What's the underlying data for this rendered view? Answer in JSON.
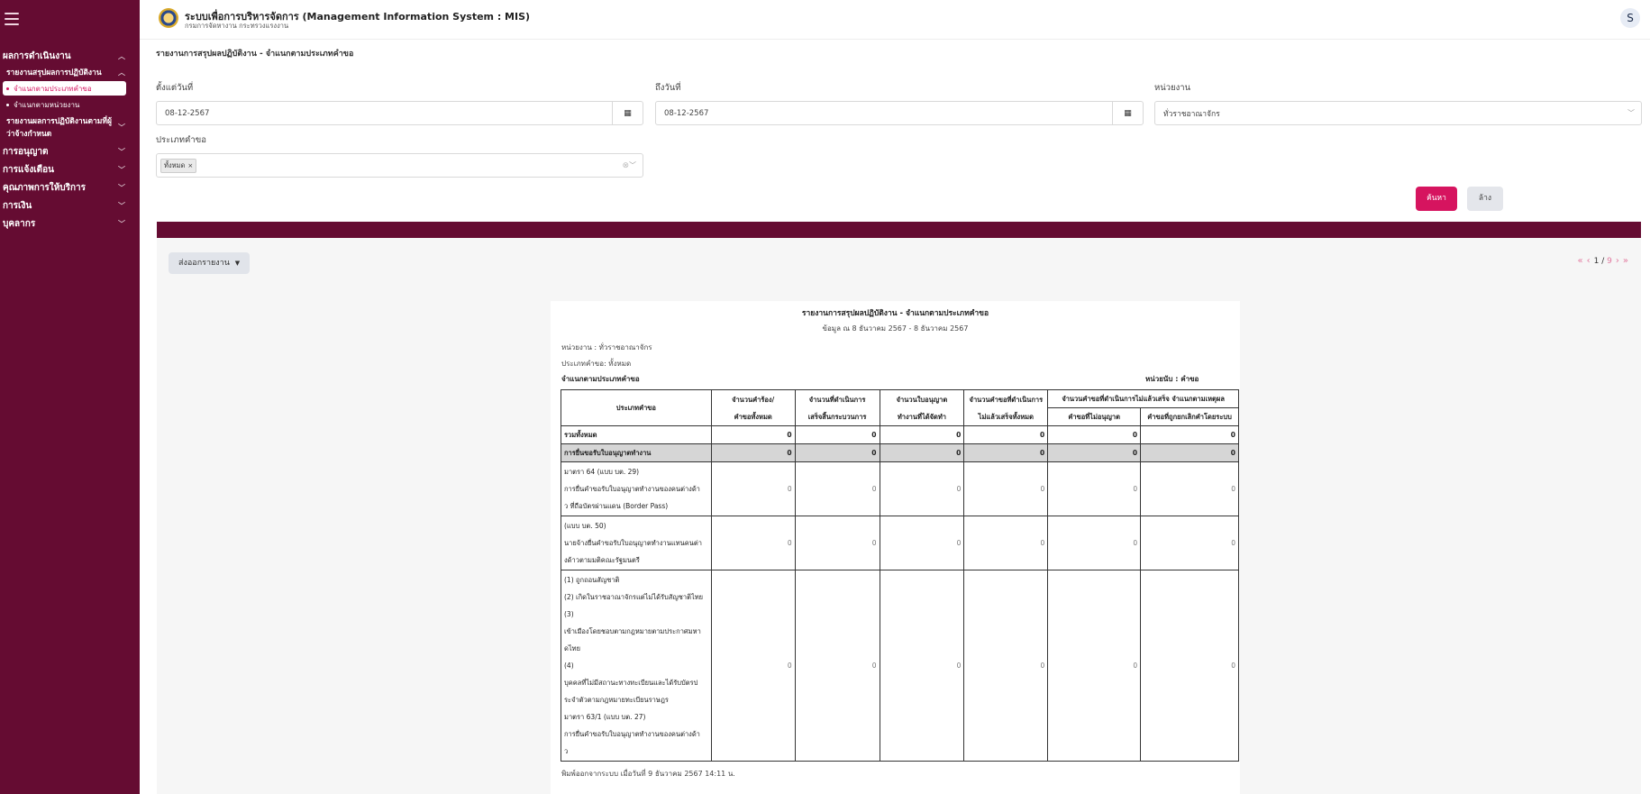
{
  "app": {
    "title": "ระบบเพื่อการบริหารจัดการ (Management Information System : MIS)",
    "subtitle": "กรมการจัดหางาน กระทรวงแรงงาน",
    "avatar_initial": "S"
  },
  "sidebar": {
    "groups": [
      {
        "label": "ผลการดำเนินงาน",
        "chevron": "^"
      },
      {
        "label": "การอนุญาต",
        "chevron": "v"
      },
      {
        "label": "การแจ้งเตือน",
        "chevron": "v"
      },
      {
        "label": "คุณภาพการให้บริการ",
        "chevron": "v"
      },
      {
        "label": "การเงิน",
        "chevron": "v"
      },
      {
        "label": "บุคลากร",
        "chevron": "v"
      }
    ],
    "sub1": {
      "label": "รายงานสรุปผลการปฏิบัติงาน",
      "chevron": "^"
    },
    "items": [
      {
        "label": "จำแนกตามประเภทคำขอ"
      },
      {
        "label": "จำแนกตามหน่วยงาน"
      }
    ],
    "sub2": {
      "line1": "รายงานผลการปฏิบัติงานตามที่ผู้",
      "line2": "ว่าจ้างกำหนด",
      "chevron": "v"
    }
  },
  "page": {
    "title": "รายงานการสรุปผลปฏิบัติงาน - จำแนกตามประเภทคำขอ"
  },
  "filters": {
    "from_label": "ตั้งแต่วันที่",
    "from_value": "08-12-2567",
    "to_label": "ถึงวันที่",
    "to_value": "08-12-2567",
    "unit_label": "หน่วยงาน",
    "unit_value": "ทั่วราชอาณาจักร",
    "type_label": "ประเภทคำขอ",
    "type_tag": "ทั้งหมด",
    "calendar_icon": "▦"
  },
  "buttons": {
    "search": "ค้นหา",
    "clear": "ล้าง",
    "export": "ส่งออกรายงาน"
  },
  "pager": {
    "current": "1",
    "total": "9"
  },
  "report": {
    "title": "รายงานการสรุปผลปฏิบัติงาน - จำแนกตามประเภทคำขอ",
    "subtitle": "ข้อมูล ณ 8 ธันวาคม 2567 - 8 ธันวาคม 2567",
    "unit_line": "หน่วยงาน : ทั่วราชอาณาจักร",
    "type_line": "ประเภทคำขอ: ทั้งหมด",
    "left_heading": "จำแนกตามประเภทคำขอ",
    "right_heading": "หน่วยนับ : คำขอ",
    "columns": {
      "type": "ประเภทคำขอ",
      "c1a": "จำนวนคำร้อง/",
      "c1b": "คำขอทั้งหมด",
      "c2a": "จำนวนที่ดำเนินการ",
      "c2b": "เสร็จสิ้นกระบวนการ",
      "c3a": "จำนวนใบอนุญาต",
      "c3b": "ทำงานที่ได้จัดทำ",
      "c4a": "จำนวนคำขอที่ดำเนินการ",
      "c4b": "ไม่แล้วเสร็จทั้งหมด",
      "c5": "จำนวนคำขอที่ดำเนินการไม่แล้วเสร็จ จำแนกตามเหตุผล",
      "c5a": "คำขอที่ไม่อนุญาต",
      "c5b": "คำขอที่ถูกยกเลิกคำโดยระบบ"
    },
    "rows": [
      {
        "type": "total",
        "label": "รวมทั้งหมด",
        "values": [
          "0",
          "0",
          "0",
          "0",
          "0",
          "0"
        ]
      },
      {
        "type": "cat",
        "label": "การยื่นขอรับใบอนุญาตทำงาน",
        "values": [
          "0",
          "0",
          "0",
          "0",
          "0",
          "0"
        ]
      },
      {
        "type": "detail",
        "lines": [
          "มาตรา 64 (แบบ บต. 29)",
          "การยื่นคำขอรับใบอนุญาตทำงานของคนต่างด้า",
          "ว ที่ถือบัตรผ่านแดน (Border Pass)"
        ],
        "values": [
          "0",
          "0",
          "0",
          "0",
          "0",
          "0"
        ]
      },
      {
        "type": "detail",
        "lines": [
          "(แบบ บต. 50)",
          "นายจ้างยื่นคำขอรับใบอนุญาตทำงานแทนคนต่า",
          "งด้าวตามมติคณะรัฐมนตรี"
        ],
        "values": [
          "0",
          "0",
          "0",
          "0",
          "0",
          "0"
        ]
      },
      {
        "type": "detail",
        "lines": [
          "(1) ถูกถอนสัญชาติ",
          "(2) เกิดในราชอาณาจักรแต่ไม่ได้รับสัญชาติไทย",
          "(3)",
          "เข้าเมืองโดยชอบตามกฎหมายตามประกาศมหา",
          "ดไทย",
          "(4)",
          "บุคคลที่ไม่มีสถานะทางทะเบียนและได้รับบัตรป",
          "ระจำตัวตามกฎหมายทะเบียนราษฎร",
          "มาตรา 63/1 (แบบ บต. 27)",
          "การยื่นคำขอรับใบอนุญาตทำงานของคนต่างด้า",
          "ว"
        ],
        "values": [
          "0",
          "0",
          "0",
          "0",
          "0",
          "0"
        ]
      }
    ],
    "footer": "พิมพ์ออกจากระบบ เมื่อวันที่ 9 ธันวาคม 2567 14:11 น."
  }
}
